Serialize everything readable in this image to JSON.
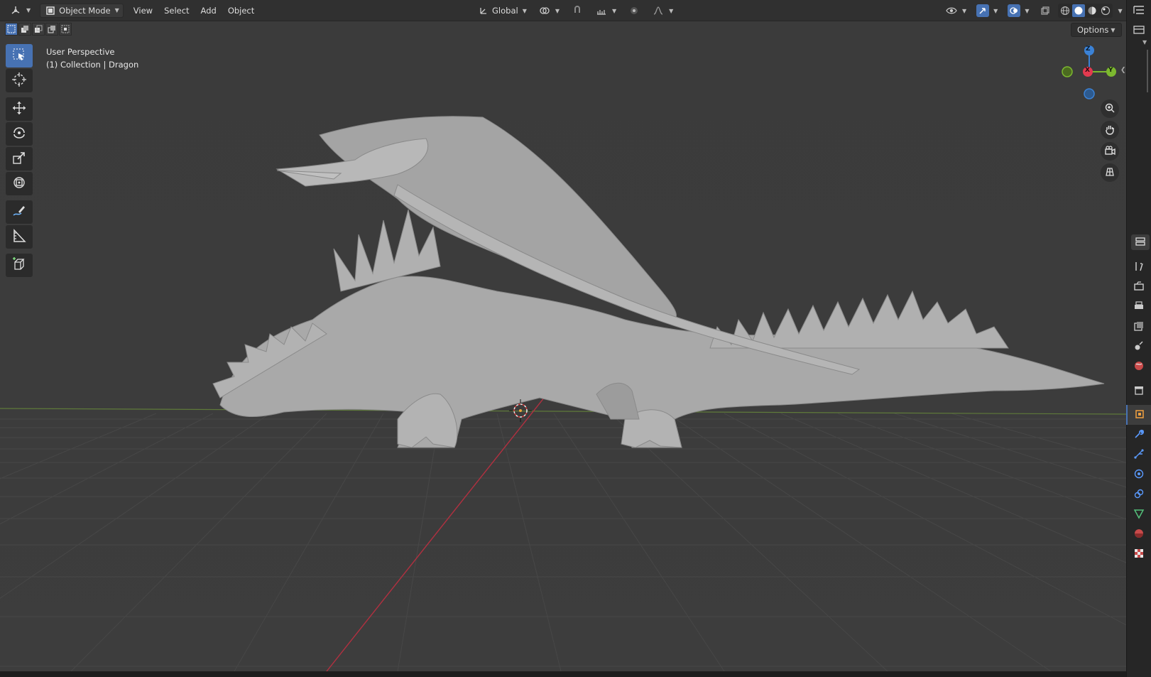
{
  "header": {
    "mode_label": "Object Mode",
    "menus": [
      "View",
      "Select",
      "Add",
      "Object"
    ],
    "orientation_label": "Global"
  },
  "viewport": {
    "view_name": "User Perspective",
    "collection_info": "(1) Collection | Dragon",
    "options_label": "Options"
  },
  "gizmo": {
    "x_label": "X",
    "y_label": "Y",
    "z_label": "Z"
  },
  "toolbar": {
    "tools": [
      "select-box",
      "cursor",
      "move",
      "rotate",
      "scale",
      "transform",
      "annotate",
      "measure",
      "add-cube"
    ],
    "active_tool": "select-box"
  },
  "properties_tabs": [
    "tool",
    "render",
    "output",
    "view-layer",
    "scene",
    "world",
    "collection",
    "object",
    "modifiers",
    "particles",
    "physics",
    "constraints",
    "data",
    "material",
    "texture"
  ],
  "active_properties_tab": "object",
  "colors": {
    "accent": "#4772b3",
    "x_axis": "#e33a4f",
    "y_axis": "#7cb82f",
    "z_axis": "#3b82d6",
    "viewport_bg": "#3d3d3d",
    "header_bg": "#303030"
  }
}
